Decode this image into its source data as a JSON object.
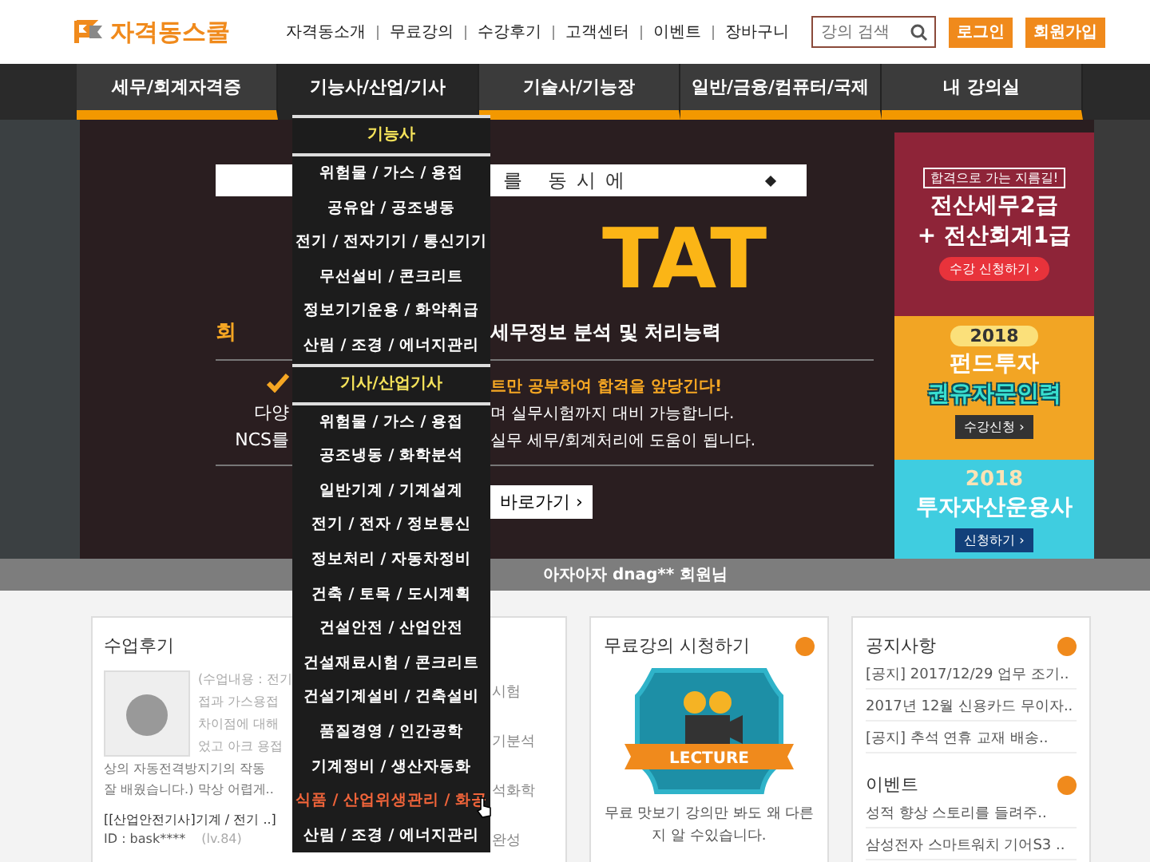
{
  "header": {
    "logo": "자격동스쿨",
    "links": [
      "자격동소개",
      "무료강의",
      "수강후기",
      "고객센터",
      "이벤트",
      "장바구니"
    ],
    "search": {
      "placeholder": "강의 검색"
    },
    "buttons": [
      "로그인",
      "회원가입"
    ]
  },
  "category_tabs": [
    {
      "label": "세무/회계자격증",
      "selected": false
    },
    {
      "label": "기능사/산업/기사",
      "selected": true
    },
    {
      "label": "기술사/기능장",
      "selected": false
    },
    {
      "label": "일반/금융/컴퓨터/국제",
      "selected": false
    },
    {
      "label": "내 강의실",
      "selected": false
    }
  ],
  "dropdown": {
    "sections": [
      {
        "heading": "기능사",
        "items": [
          {
            "label": "위험물 / 가스 / 용접",
            "selected": false
          },
          {
            "label": "공유압 / 공조냉동",
            "selected": false
          },
          {
            "label": "전기 / 전자기기 / 통신기기",
            "selected": false
          },
          {
            "label": "무선설비 / 콘크리트",
            "selected": false
          },
          {
            "label": "정보기기운용 / 화약취급",
            "selected": false
          },
          {
            "label": "산림 / 조경 / 에너지관리",
            "selected": false
          }
        ]
      },
      {
        "heading": "기사/산업기사",
        "items": [
          {
            "label": "위험물 / 가스 / 용접",
            "selected": false
          },
          {
            "label": "공조냉동 / 화학분석",
            "selected": false
          },
          {
            "label": "일반기계 / 기계설계",
            "selected": false
          },
          {
            "label": "전기 / 전자 / 정보통신",
            "selected": false
          },
          {
            "label": "정보처리 / 자동차정비",
            "selected": false
          },
          {
            "label": "건축 / 토목 / 도시계획",
            "selected": false
          },
          {
            "label": "건설안전 / 산업안전",
            "selected": false
          },
          {
            "label": "건설재료시험 / 콘크리트",
            "selected": false
          },
          {
            "label": "건설기계설비 / 건축설비",
            "selected": false
          },
          {
            "label": "품질경영 / 인간공학",
            "selected": false
          },
          {
            "label": "기계정비 / 생산자동화",
            "selected": false
          },
          {
            "label": "식품 / 산업위생관리 / 화공",
            "selected": true
          },
          {
            "label": "산림 / 조경 / 에너지관리",
            "selected": false
          }
        ]
      }
    ]
  },
  "hero": {
    "box_text": "를 동시에",
    "title": "TAT",
    "left_sub": "회",
    "subtitle": "**세무정보** 분석 및 처리능력",
    "left_lines": [
      "다양",
      "NCS를"
    ],
    "highlight": "트만 공부하여 합격을 앞당긴다!",
    "lines": [
      "며 실무시험까지 대비 가능합니다.",
      "실무 세무/회계처리에 도움이 됩니다."
    ],
    "button": "바로가기 ›"
  },
  "banners": [
    {
      "color": "#8e2438",
      "tag": "합격으로 가는 지름길!",
      "lines": [
        "전산세무2급",
        "+ 전산회계1급"
      ],
      "button": "수강 신청하기 ›"
    },
    {
      "color": "#f2a524",
      "year": "2018",
      "lines": [
        "펀드투자",
        "권유자문인력"
      ],
      "button": "수강신청 ›"
    },
    {
      "color": "#3fcde0",
      "year": "2018",
      "lines": [
        "투자자산운용사"
      ],
      "button": "신청하기 ›"
    }
  ],
  "ticker": "아자아자 dnag** 회원님",
  "review_card": {
    "title": "수업후기",
    "text_lines": [
      "(수업내용 : 전기",
      "접과 가스용접",
      "차이점에 대해",
      "었고 아크 용접"
    ],
    "wide_lines": [
      "상의 자동전격방지기의 작동",
      "잘 배웠습니다.) 막상 어렵게.."
    ],
    "course": "[[산업안전기사]기계 / 전기 ..]",
    "user": "ID : bask****",
    "level": "(lv.84)",
    "fragments": [
      "시험",
      "기분석",
      "석화학",
      "완성"
    ]
  },
  "free_lecture_card": {
    "title": "무료강의 시청하기",
    "badge_text": "LECTURE",
    "text": "무료 맛보기 강의만 봐도 왜 다른지 알 수있습니다."
  },
  "notice_card": {
    "title": "공지사항",
    "notices": [
      "[공지] 2017/12/29 업무 조기..",
      "2017년 12월 신용카드 무이자..",
      "[공지] 추석 연휴 교재 배송.."
    ],
    "event_title": "이벤트",
    "events": [
      "성적 향상 스토리를 들려주..",
      "삼성전자 스마트워치 기어S3 .."
    ]
  }
}
